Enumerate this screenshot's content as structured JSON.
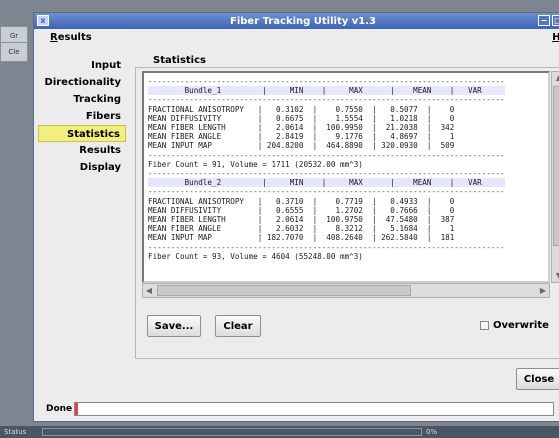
{
  "window": {
    "title": "Fiber Tracking Utility v1.3"
  },
  "desktop_tabs": [
    {
      "label": "Gr"
    },
    {
      "label": "Cle"
    }
  ],
  "titlebar": {
    "icon": "x",
    "minimize": "−",
    "maximize": "□",
    "close": "×"
  },
  "menubar": {
    "results_first": "R",
    "results_rest": "esults",
    "help_first": "H",
    "help_rest": "elp"
  },
  "nav": {
    "items": [
      {
        "label": "Input"
      },
      {
        "label": "Directionality"
      },
      {
        "label": "Tracking"
      },
      {
        "label": "Fibers"
      },
      {
        "label": "Statistics"
      },
      {
        "label": "Results"
      },
      {
        "label": "Display"
      }
    ],
    "active": "Statistics"
  },
  "statistics": {
    "title": "Statistics",
    "bundles": [
      {
        "name": "Bundle_1",
        "headers": [
          "MIN",
          "MAX",
          "MEAN",
          "VAR"
        ],
        "rows": [
          [
            "FRACTIONAL ANISOTROPY",
            "0.3102",
            "0.7550",
            "0.5077",
            "0"
          ],
          [
            "MEAN DIFFUSIVITY",
            "0.6675",
            "1.5554",
            "1.0218",
            "0"
          ],
          [
            "MEAN FIBER LENGTH",
            "2.0614",
            "100.9950",
            "21.2038",
            "342"
          ],
          [
            "MEAN FIBER ANGLE",
            "2.8419",
            "9.1776",
            "4.8697",
            "1"
          ],
          [
            "MEAN INPUT MAP",
            "204.8200",
            "464.8890",
            "320.0930",
            "509"
          ]
        ],
        "summary": "Fiber Count = 91, Volume = 1711 (20532.00 mm^3)"
      },
      {
        "name": "Bundle_2",
        "headers": [
          "MIN",
          "MAX",
          "MEAN",
          "VAR"
        ],
        "rows": [
          [
            "FRACTIONAL ANISOTROPY",
            "0.3710",
            "0.7719",
            "0.4933",
            "0"
          ],
          [
            "MEAN DIFFUSIVITY",
            "0.6555",
            "1.2702",
            "0.7666",
            "0"
          ],
          [
            "MEAN FIBER LENGTH",
            "2.0614",
            "100.9750",
            "47.5480",
            "387"
          ],
          [
            "MEAN FIBER ANGLE",
            "2.6032",
            "8.3212",
            "5.1684",
            "1"
          ],
          [
            "MEAN INPUT MAP",
            "182.7070",
            "408.2640",
            "262.5840",
            "181"
          ]
        ],
        "summary": "Fiber Count = 93, Volume = 4604 (55248.00 mm^3)"
      }
    ]
  },
  "buttons": {
    "save": "Save...",
    "clear": "Clear",
    "close": "Close"
  },
  "overwrite": {
    "label": "Overwrite",
    "checked": false
  },
  "status": {
    "label": "Done",
    "percent": "0%"
  },
  "bottom_strip": {
    "label": "Status",
    "percent": "0%"
  },
  "colors": {
    "titlebar": "#3d63b5",
    "nav_active": "#f3ef7e",
    "desktop": "#7d8590"
  }
}
